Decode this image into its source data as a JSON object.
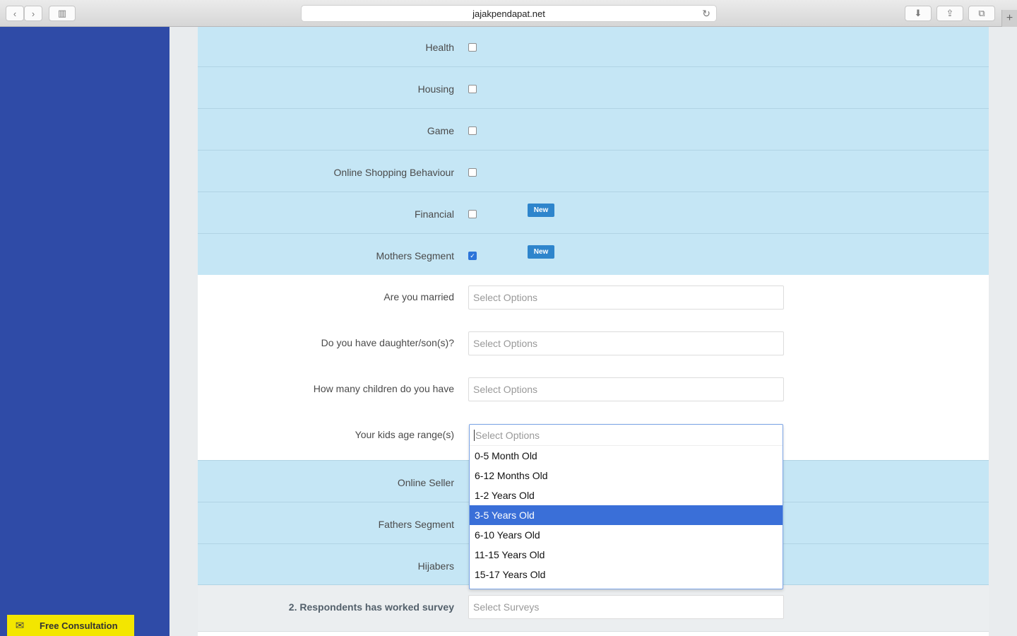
{
  "browser": {
    "url": "jajakpendapat.net",
    "back_icon": "‹",
    "forward_icon": "›",
    "sidebar_icon": "▥",
    "reload_icon": "↻",
    "download_icon": "⬇",
    "share_icon": "⇪",
    "tabs_icon": "⧉",
    "new_tab_icon": "+"
  },
  "checkbox_rows": [
    {
      "label": "Health",
      "checked": false
    },
    {
      "label": "Housing",
      "checked": false
    },
    {
      "label": "Game",
      "checked": false
    },
    {
      "label": "Online Shopping Behaviour",
      "checked": false
    },
    {
      "label": "Financial",
      "checked": false,
      "badge": "New"
    },
    {
      "label": "Mothers Segment",
      "checked": true,
      "badge": "New"
    }
  ],
  "mothers_questions": [
    {
      "label": "Are you married",
      "placeholder": "Select Options"
    },
    {
      "label": "Do you have daughter/son(s)?",
      "placeholder": "Select Options"
    },
    {
      "label": "How many children do you have",
      "placeholder": "Select Options"
    },
    {
      "label": "Your kids age range(s)",
      "placeholder": "Select Options"
    }
  ],
  "lower_rows": [
    {
      "label": "Online Seller"
    },
    {
      "label": "Fathers Segment"
    },
    {
      "label": "Hijabers"
    }
  ],
  "dropdown": {
    "placeholder": "Select Options",
    "options": [
      "0-5 Month Old",
      "6-12 Months Old",
      "1-2 Years Old",
      "3-5 Years Old",
      "6-10 Years Old",
      "11-15 Years Old",
      "15-17 Years Old"
    ],
    "highlighted": "3-5 Years Old"
  },
  "section2": {
    "label": "2. Respondents has worked survey",
    "placeholder": "Select Surveys"
  },
  "consultation": {
    "icon": "✉",
    "label": "Free Consultation"
  },
  "colors": {
    "sidebar": "#2f4ba7",
    "row_blue": "#c5e6f5",
    "badge": "#2e85cc",
    "highlight": "#3a6fd8",
    "consult": "#f3e600"
  }
}
